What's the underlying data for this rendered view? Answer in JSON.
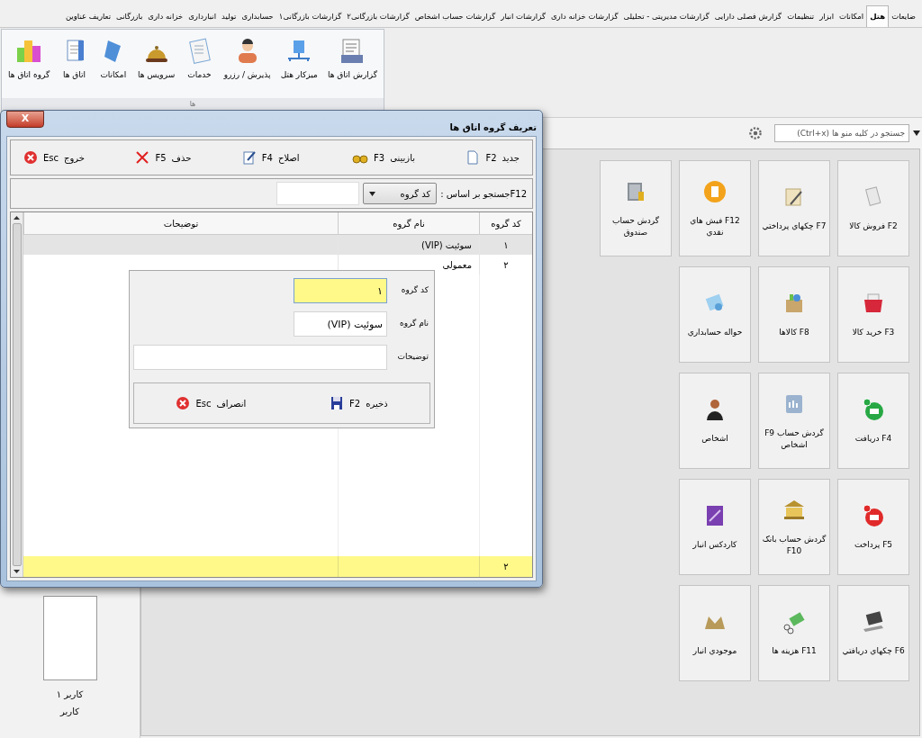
{
  "menu_tabs": [
    {
      "label": "ضایعات",
      "selected": false
    },
    {
      "label": "هتل",
      "selected": true
    },
    {
      "label": "امکانات",
      "selected": false
    },
    {
      "label": "ابزار",
      "selected": false
    },
    {
      "label": "تنظیمات",
      "selected": false
    },
    {
      "label": "گزارش فصلی دارایی",
      "selected": false
    },
    {
      "label": "گزارشات مدیریتی - تحلیلی",
      "selected": false
    },
    {
      "label": "گزارشات خزانه داری",
      "selected": false
    },
    {
      "label": "گزارشات انبار",
      "selected": false
    },
    {
      "label": "گزارشات حساب اشخاص",
      "selected": false
    },
    {
      "label": "گزارشات بازرگانی۲",
      "selected": false
    },
    {
      "label": "گزارشات بازرگانی۱",
      "selected": false
    },
    {
      "label": "حسابداری",
      "selected": false
    },
    {
      "label": "تولید",
      "selected": false
    },
    {
      "label": "انبارداری",
      "selected": false
    },
    {
      "label": "خزانه داری",
      "selected": false
    },
    {
      "label": "بازرگانی",
      "selected": false
    },
    {
      "label": "تعاریف عناوین",
      "selected": false
    }
  ],
  "ribbon": {
    "items": [
      "گزارش اتاق ها",
      "میزکار هتل",
      "پذیرش / رزرو",
      "خدمات",
      "سرویس ها",
      "امکانات",
      "اتاق ها",
      "گروه اتاق ها"
    ],
    "group_label": "ها"
  },
  "menu_search": {
    "placeholder": "جستجو در کلیه منو ها (Ctrl+x)"
  },
  "user": {
    "name": "کاربر ۱",
    "role": "کاربر"
  },
  "tiles": [
    [
      "F2 فروش کالا",
      "F7 چکهاي پرداختي",
      "F12 فيش هاي نقدي",
      "گردش حساب صندوق"
    ],
    [
      "F3 خريد کالا",
      "F8 کالاها",
      "حواله حسابداري"
    ],
    [
      "F4 دريافت",
      "گردش حساب F9 اشخاص",
      "اشخاص"
    ],
    [
      "F5 پرداخت",
      "گردش حساب بانک F10",
      "کاردکس انبار"
    ],
    [
      "F6 چکهاي دريافتي",
      "F11 هزينه ها",
      "موجودي انبار"
    ]
  ],
  "dialog": {
    "title": "تعریف گروه اتاق ها",
    "close": "X",
    "toolbar": [
      {
        "label": "جدید",
        "key": "F2",
        "kind": "new"
      },
      {
        "label": "بازبینی",
        "key": "F3",
        "kind": "review"
      },
      {
        "label": "اصلاح",
        "key": "F4",
        "kind": "edit"
      },
      {
        "label": "حذف",
        "key": "F5",
        "kind": "delete"
      },
      {
        "label": "خروج",
        "key": "Esc",
        "kind": "exit"
      }
    ],
    "search": {
      "label": "F12جستجو بر اساس :",
      "by": "کد گروه"
    },
    "table": {
      "columns": [
        "کد گروه",
        "نام گروه",
        "توضیحات"
      ],
      "rows": [
        {
          "code": "۱",
          "name": "سوئیت (VIP)",
          "selected": true
        },
        {
          "code": "۲",
          "name": "معمولی",
          "selected": false
        }
      ],
      "footer": "۲"
    },
    "edit_form": {
      "fields": [
        {
          "label": "کد گروه",
          "value": "۱",
          "focused": true
        },
        {
          "label": "نام گروه",
          "value": "سوئیت (VIP)",
          "focused": false
        },
        {
          "label": "توضیحات",
          "focused": false
        }
      ],
      "buttons": [
        {
          "label": "ذخیره",
          "key": "F2",
          "kind": "save"
        },
        {
          "label": "انصراف",
          "key": "Esc",
          "kind": "cancel"
        }
      ]
    }
  }
}
